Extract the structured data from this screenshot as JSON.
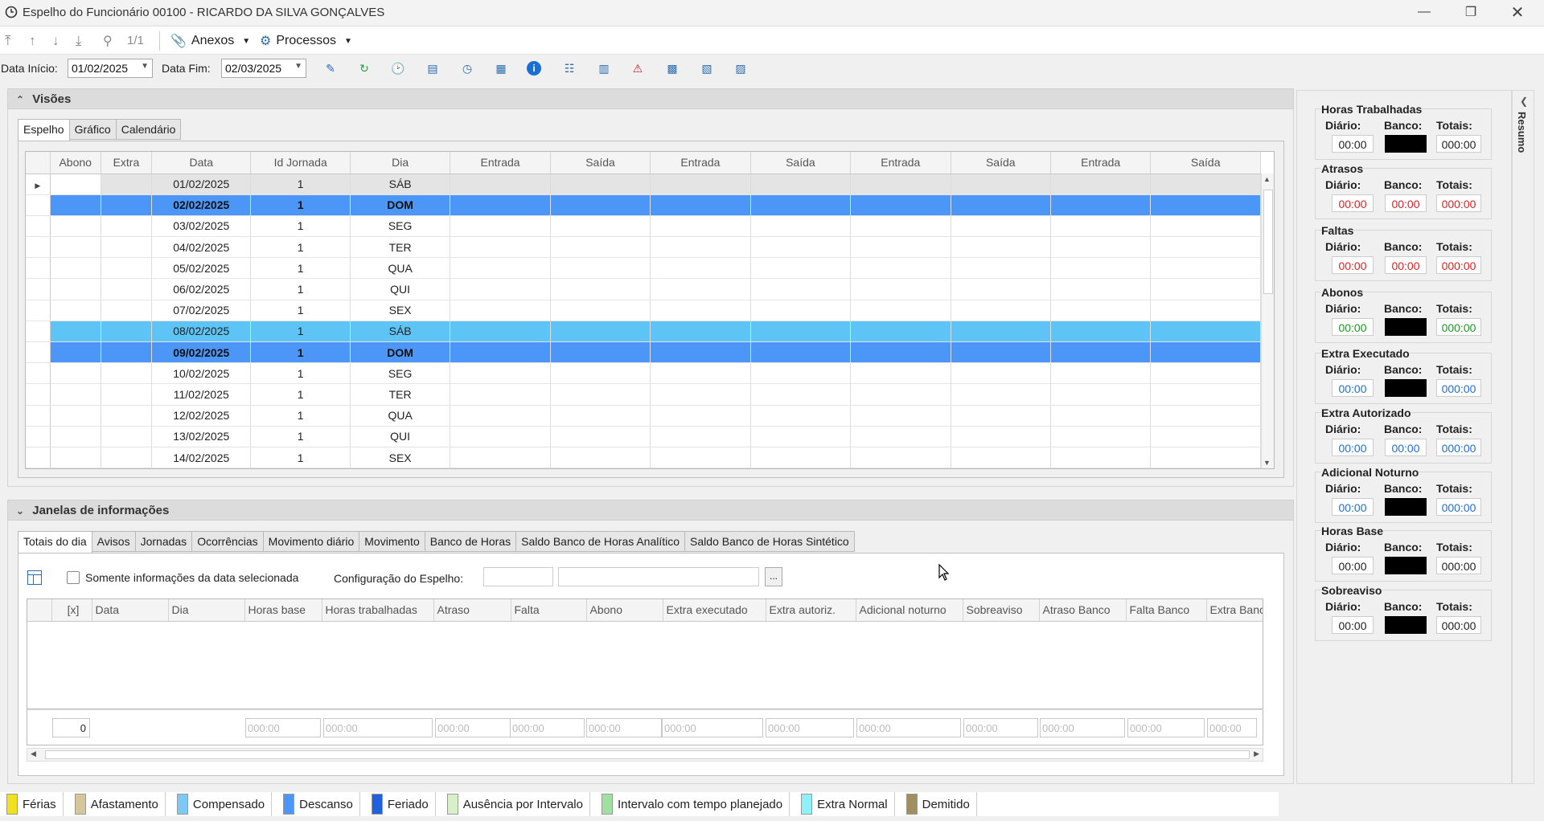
{
  "window": {
    "title": "Espelho do Funcionário 00100 - RICARDO DA SILVA GONÇALVES"
  },
  "toolbar": {
    "record_counter": "1/1",
    "anexos_label": "Anexos",
    "processos_label": "Processos"
  },
  "filters": {
    "data_inicio_label": "Data Início:",
    "data_inicio_value": "01/02/2025",
    "data_fim_label": "Data Fim:",
    "data_fim_value": "02/03/2025"
  },
  "visoes": {
    "header": "Visões",
    "tabs": [
      "Espelho",
      "Gráfico",
      "Calendário"
    ],
    "columns": [
      "Abono",
      "Extra",
      "Data",
      "Id Jornada",
      "Dia",
      "Entrada",
      "Saída",
      "Entrada",
      "Saída",
      "Entrada",
      "Saída",
      "Entrada",
      "Saída"
    ],
    "rows": [
      {
        "data": "01/02/2025",
        "jornada": "1",
        "dia": "SÁB",
        "style": "gray"
      },
      {
        "data": "02/02/2025",
        "jornada": "1",
        "dia": "DOM",
        "style": "hi"
      },
      {
        "data": "03/02/2025",
        "jornada": "1",
        "dia": "SEG",
        "style": ""
      },
      {
        "data": "04/02/2025",
        "jornada": "1",
        "dia": "TER",
        "style": ""
      },
      {
        "data": "05/02/2025",
        "jornada": "1",
        "dia": "QUA",
        "style": ""
      },
      {
        "data": "06/02/2025",
        "jornada": "1",
        "dia": "QUI",
        "style": ""
      },
      {
        "data": "07/02/2025",
        "jornada": "1",
        "dia": "SEX",
        "style": ""
      },
      {
        "data": "08/02/2025",
        "jornada": "1",
        "dia": "SÁB",
        "style": "lb"
      },
      {
        "data": "09/02/2025",
        "jornada": "1",
        "dia": "DOM",
        "style": "hi"
      },
      {
        "data": "10/02/2025",
        "jornada": "1",
        "dia": "SEG",
        "style": ""
      },
      {
        "data": "11/02/2025",
        "jornada": "1",
        "dia": "TER",
        "style": ""
      },
      {
        "data": "12/02/2025",
        "jornada": "1",
        "dia": "QUA",
        "style": ""
      },
      {
        "data": "13/02/2025",
        "jornada": "1",
        "dia": "QUI",
        "style": ""
      },
      {
        "data": "14/02/2025",
        "jornada": "1",
        "dia": "SEX",
        "style": ""
      }
    ]
  },
  "janelas": {
    "header": "Janelas de informações",
    "tabs": [
      "Totais do dia",
      "Avisos",
      "Jornadas",
      "Ocorrências",
      "Movimento diário",
      "Movimento",
      "Banco de Horas",
      "Saldo Banco de Horas Analítico",
      "Saldo Banco de Horas Sintético"
    ],
    "checkbox_label": "Somente informações da data selecionada",
    "config_label": "Configuração do Espelho:",
    "config_button": "...",
    "columns": [
      "[x]",
      "Data",
      "Dia",
      "Horas base",
      "Horas trabalhadas",
      "Atraso",
      "Falta",
      "Abono",
      "Extra executado",
      "Extra autoriz.",
      "Adicional noturno",
      "Sobreaviso",
      "Atraso Banco",
      "Falta Banco",
      "Extra Banco"
    ],
    "count": "0",
    "summary_placeholder": "000:00"
  },
  "resumo": {
    "tab_label": "Resumo",
    "col_labels": {
      "diario": "Diário:",
      "banco": "Banco:",
      "totais": "Totais:"
    },
    "groups": [
      {
        "title": "Horas Trabalhadas",
        "diario": "00:00",
        "banco": "",
        "totais": "000:00",
        "color": "#222222"
      },
      {
        "title": "Atrasos",
        "diario": "00:00",
        "banco": "00:00",
        "totais": "000:00",
        "color": "#e02020"
      },
      {
        "title": "Faltas",
        "diario": "00:00",
        "banco": "00:00",
        "totais": "000:00",
        "color": "#e02020"
      },
      {
        "title": "Abonos",
        "diario": "00:00",
        "banco": "",
        "totais": "000:00",
        "color": "#1a9a1a"
      },
      {
        "title": "Extra Executado",
        "diario": "00:00",
        "banco": "",
        "totais": "000:00",
        "color": "#2070d0"
      },
      {
        "title": "Extra Autorizado",
        "diario": "00:00",
        "banco": "00:00",
        "totais": "000:00",
        "color": "#2070d0"
      },
      {
        "title": "Adicional Noturno",
        "diario": "00:00",
        "banco": "",
        "totais": "000:00",
        "color": "#2070d0"
      },
      {
        "title": "Horas Base",
        "diario": "00:00",
        "banco": "",
        "totais": "000:00",
        "color": "#222222"
      },
      {
        "title": "Sobreaviso",
        "diario": "00:00",
        "banco": "",
        "totais": "000:00",
        "color": "#222222"
      }
    ]
  },
  "legend": [
    {
      "label": "Férias",
      "color": "#f0e020"
    },
    {
      "label": "Afastamento",
      "color": "#d4c89a"
    },
    {
      "label": "Compensado",
      "color": "#7ec8f5"
    },
    {
      "label": "Descanso",
      "color": "#4c96f7"
    },
    {
      "label": "Feriado",
      "color": "#2060e0"
    },
    {
      "label": "Ausência por Intervalo",
      "color": "#d8f0c8"
    },
    {
      "label": "Intervalo com tempo planejado",
      "color": "#a0e0a0"
    },
    {
      "label": "Extra Normal",
      "color": "#90f0f8"
    },
    {
      "label": "Demitido",
      "color": "#a09060"
    }
  ]
}
